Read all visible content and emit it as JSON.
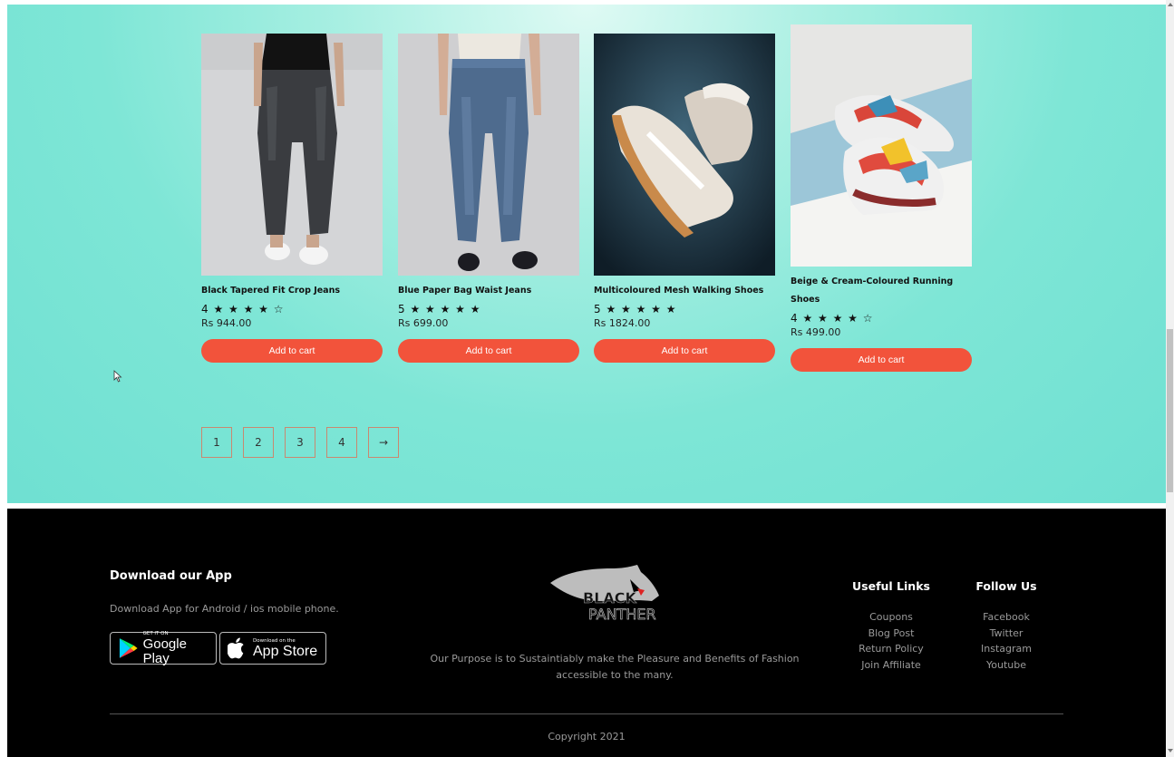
{
  "products": [
    {
      "title": "Black Tapered Fit Crop Jeans",
      "rating": "4 ★ ★ ★ ★ ☆",
      "price": "Rs 944.00",
      "button": "Add to cart"
    },
    {
      "title": "Blue Paper Bag Waist Jeans",
      "rating": "5 ★ ★ ★ ★ ★",
      "price": "Rs 699.00",
      "button": "Add to cart"
    },
    {
      "title": "Multicoloured Mesh Walking Shoes",
      "rating": "5 ★ ★ ★ ★ ★",
      "price": "Rs 1824.00",
      "button": "Add to cart"
    },
    {
      "title": "Beige & Cream-Coloured Running Shoes",
      "rating": "4 ★ ★ ★ ★ ☆",
      "price": "Rs 499.00",
      "button": "Add to cart"
    }
  ],
  "pagination": [
    "1",
    "2",
    "3",
    "4",
    "→"
  ],
  "footer": {
    "app_title": "Download our App",
    "app_desc": "Download App for Android / ios mobile phone.",
    "google_small": "GET IT ON",
    "google_big": "Google Play",
    "apple_small": "Download on the",
    "apple_big": "App Store",
    "logo_line1": "BLACK",
    "logo_line2": "PANTHER",
    "purpose": "Our Purpose is to Sustaintiably make the Pleasure and Benefits of Fashion accessible to the many.",
    "useful_title": "Useful Links",
    "useful_links": [
      "Coupons",
      "Blog Post",
      "Return Policy",
      "Join Affiliate"
    ],
    "follow_title": "Follow Us",
    "follow_links": [
      "Facebook",
      "Twitter",
      "Instagram",
      "Youtube"
    ],
    "copyright": "Copyright 2021"
  }
}
